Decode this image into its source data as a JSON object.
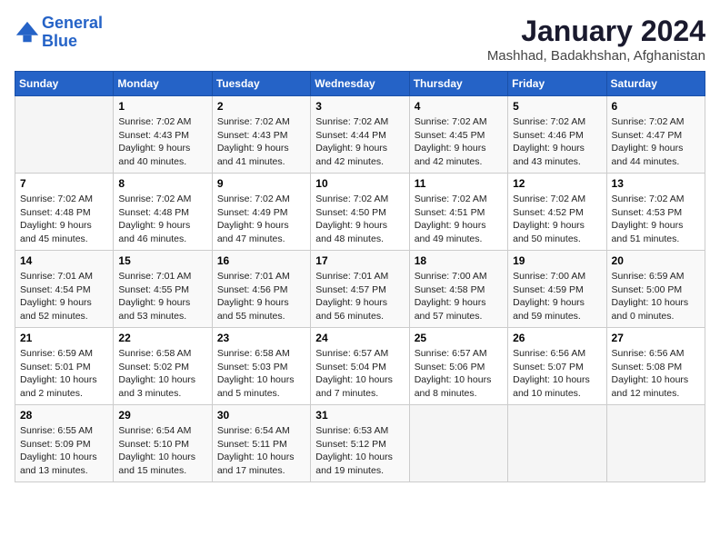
{
  "logo": {
    "line1": "General",
    "line2": "Blue"
  },
  "title": "January 2024",
  "location": "Mashhad, Badakhshan, Afghanistan",
  "weekdays": [
    "Sunday",
    "Monday",
    "Tuesday",
    "Wednesday",
    "Thursday",
    "Friday",
    "Saturday"
  ],
  "weeks": [
    [
      {
        "day": "",
        "sunrise": "",
        "sunset": "",
        "daylight": ""
      },
      {
        "day": "1",
        "sunrise": "Sunrise: 7:02 AM",
        "sunset": "Sunset: 4:43 PM",
        "daylight": "Daylight: 9 hours and 40 minutes."
      },
      {
        "day": "2",
        "sunrise": "Sunrise: 7:02 AM",
        "sunset": "Sunset: 4:43 PM",
        "daylight": "Daylight: 9 hours and 41 minutes."
      },
      {
        "day": "3",
        "sunrise": "Sunrise: 7:02 AM",
        "sunset": "Sunset: 4:44 PM",
        "daylight": "Daylight: 9 hours and 42 minutes."
      },
      {
        "day": "4",
        "sunrise": "Sunrise: 7:02 AM",
        "sunset": "Sunset: 4:45 PM",
        "daylight": "Daylight: 9 hours and 42 minutes."
      },
      {
        "day": "5",
        "sunrise": "Sunrise: 7:02 AM",
        "sunset": "Sunset: 4:46 PM",
        "daylight": "Daylight: 9 hours and 43 minutes."
      },
      {
        "day": "6",
        "sunrise": "Sunrise: 7:02 AM",
        "sunset": "Sunset: 4:47 PM",
        "daylight": "Daylight: 9 hours and 44 minutes."
      }
    ],
    [
      {
        "day": "7",
        "sunrise": "Sunrise: 7:02 AM",
        "sunset": "Sunset: 4:48 PM",
        "daylight": "Daylight: 9 hours and 45 minutes."
      },
      {
        "day": "8",
        "sunrise": "Sunrise: 7:02 AM",
        "sunset": "Sunset: 4:48 PM",
        "daylight": "Daylight: 9 hours and 46 minutes."
      },
      {
        "day": "9",
        "sunrise": "Sunrise: 7:02 AM",
        "sunset": "Sunset: 4:49 PM",
        "daylight": "Daylight: 9 hours and 47 minutes."
      },
      {
        "day": "10",
        "sunrise": "Sunrise: 7:02 AM",
        "sunset": "Sunset: 4:50 PM",
        "daylight": "Daylight: 9 hours and 48 minutes."
      },
      {
        "day": "11",
        "sunrise": "Sunrise: 7:02 AM",
        "sunset": "Sunset: 4:51 PM",
        "daylight": "Daylight: 9 hours and 49 minutes."
      },
      {
        "day": "12",
        "sunrise": "Sunrise: 7:02 AM",
        "sunset": "Sunset: 4:52 PM",
        "daylight": "Daylight: 9 hours and 50 minutes."
      },
      {
        "day": "13",
        "sunrise": "Sunrise: 7:02 AM",
        "sunset": "Sunset: 4:53 PM",
        "daylight": "Daylight: 9 hours and 51 minutes."
      }
    ],
    [
      {
        "day": "14",
        "sunrise": "Sunrise: 7:01 AM",
        "sunset": "Sunset: 4:54 PM",
        "daylight": "Daylight: 9 hours and 52 minutes."
      },
      {
        "day": "15",
        "sunrise": "Sunrise: 7:01 AM",
        "sunset": "Sunset: 4:55 PM",
        "daylight": "Daylight: 9 hours and 53 minutes."
      },
      {
        "day": "16",
        "sunrise": "Sunrise: 7:01 AM",
        "sunset": "Sunset: 4:56 PM",
        "daylight": "Daylight: 9 hours and 55 minutes."
      },
      {
        "day": "17",
        "sunrise": "Sunrise: 7:01 AM",
        "sunset": "Sunset: 4:57 PM",
        "daylight": "Daylight: 9 hours and 56 minutes."
      },
      {
        "day": "18",
        "sunrise": "Sunrise: 7:00 AM",
        "sunset": "Sunset: 4:58 PM",
        "daylight": "Daylight: 9 hours and 57 minutes."
      },
      {
        "day": "19",
        "sunrise": "Sunrise: 7:00 AM",
        "sunset": "Sunset: 4:59 PM",
        "daylight": "Daylight: 9 hours and 59 minutes."
      },
      {
        "day": "20",
        "sunrise": "Sunrise: 6:59 AM",
        "sunset": "Sunset: 5:00 PM",
        "daylight": "Daylight: 10 hours and 0 minutes."
      }
    ],
    [
      {
        "day": "21",
        "sunrise": "Sunrise: 6:59 AM",
        "sunset": "Sunset: 5:01 PM",
        "daylight": "Daylight: 10 hours and 2 minutes."
      },
      {
        "day": "22",
        "sunrise": "Sunrise: 6:58 AM",
        "sunset": "Sunset: 5:02 PM",
        "daylight": "Daylight: 10 hours and 3 minutes."
      },
      {
        "day": "23",
        "sunrise": "Sunrise: 6:58 AM",
        "sunset": "Sunset: 5:03 PM",
        "daylight": "Daylight: 10 hours and 5 minutes."
      },
      {
        "day": "24",
        "sunrise": "Sunrise: 6:57 AM",
        "sunset": "Sunset: 5:04 PM",
        "daylight": "Daylight: 10 hours and 7 minutes."
      },
      {
        "day": "25",
        "sunrise": "Sunrise: 6:57 AM",
        "sunset": "Sunset: 5:06 PM",
        "daylight": "Daylight: 10 hours and 8 minutes."
      },
      {
        "day": "26",
        "sunrise": "Sunrise: 6:56 AM",
        "sunset": "Sunset: 5:07 PM",
        "daylight": "Daylight: 10 hours and 10 minutes."
      },
      {
        "day": "27",
        "sunrise": "Sunrise: 6:56 AM",
        "sunset": "Sunset: 5:08 PM",
        "daylight": "Daylight: 10 hours and 12 minutes."
      }
    ],
    [
      {
        "day": "28",
        "sunrise": "Sunrise: 6:55 AM",
        "sunset": "Sunset: 5:09 PM",
        "daylight": "Daylight: 10 hours and 13 minutes."
      },
      {
        "day": "29",
        "sunrise": "Sunrise: 6:54 AM",
        "sunset": "Sunset: 5:10 PM",
        "daylight": "Daylight: 10 hours and 15 minutes."
      },
      {
        "day": "30",
        "sunrise": "Sunrise: 6:54 AM",
        "sunset": "Sunset: 5:11 PM",
        "daylight": "Daylight: 10 hours and 17 minutes."
      },
      {
        "day": "31",
        "sunrise": "Sunrise: 6:53 AM",
        "sunset": "Sunset: 5:12 PM",
        "daylight": "Daylight: 10 hours and 19 minutes."
      },
      {
        "day": "",
        "sunrise": "",
        "sunset": "",
        "daylight": ""
      },
      {
        "day": "",
        "sunrise": "",
        "sunset": "",
        "daylight": ""
      },
      {
        "day": "",
        "sunrise": "",
        "sunset": "",
        "daylight": ""
      }
    ]
  ]
}
